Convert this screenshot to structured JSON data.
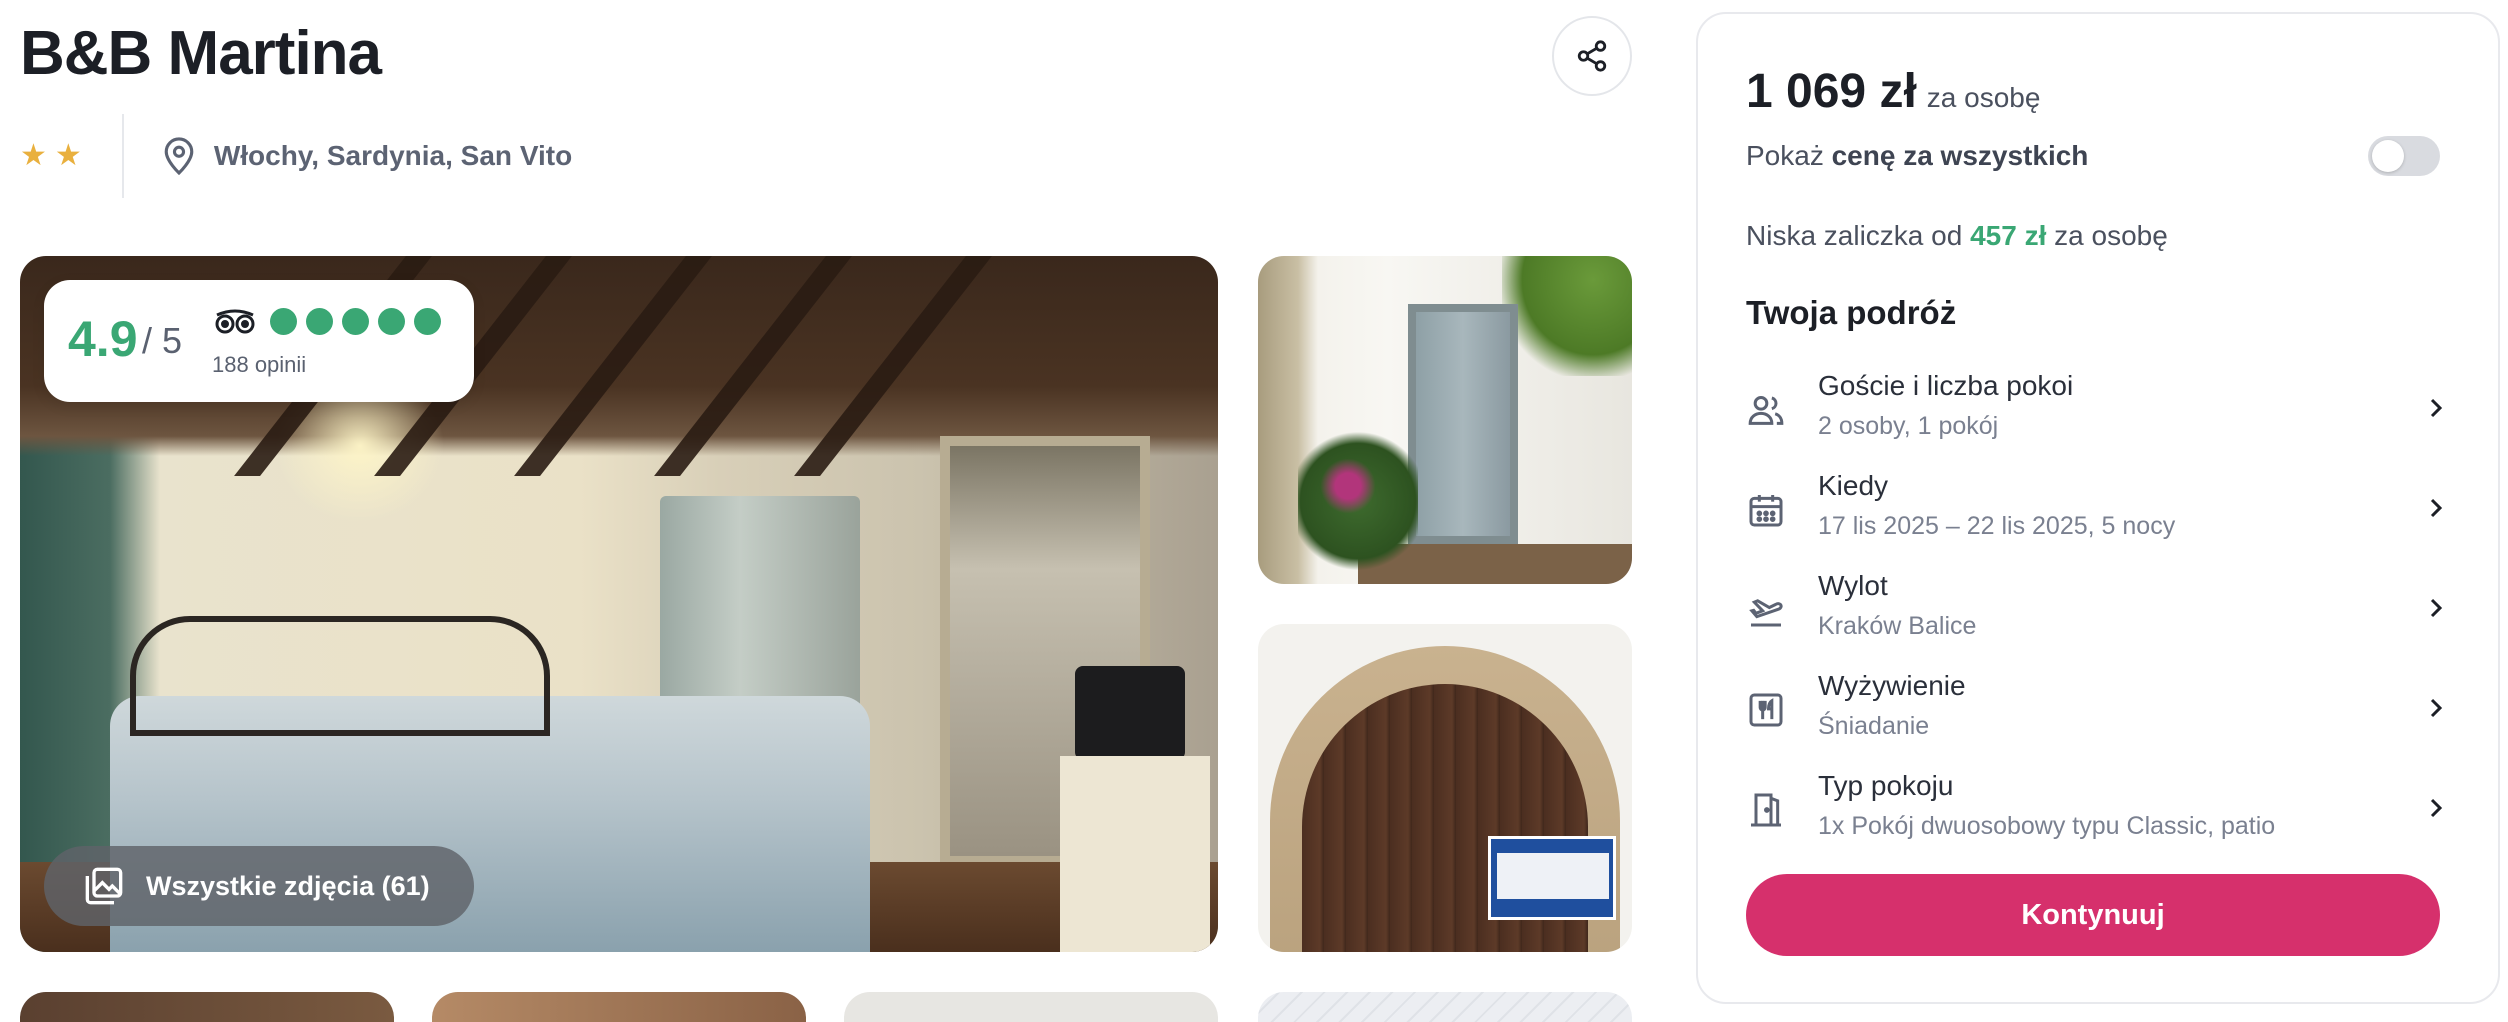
{
  "hotel": {
    "name": "B&B Martina",
    "star_count": 2,
    "location": "Włochy, Sardynia, San Vito"
  },
  "rating": {
    "score": "4.9",
    "of": "/ 5",
    "bubbles": 5,
    "reviews": "188 opinii",
    "color": "#3aa774"
  },
  "gallery": {
    "all_photos_label": "Wszystkie zdjęcia (61)"
  },
  "booking": {
    "price": "1 069 zł",
    "per_person": "za osobę",
    "toggle_prefix": "Pokaż ",
    "toggle_bold": "cenę za wszystkich",
    "toggle_on": false,
    "deposit_prefix": "Niska zaliczka od ",
    "deposit_amount": "457 zł",
    "deposit_suffix": " za osobę",
    "trip_heading": "Twoja podróż",
    "items": [
      {
        "label": "Goście i liczba pokoi",
        "value": "2 osoby, 1 pokój",
        "icon": "users-icon"
      },
      {
        "label": "Kiedy",
        "value": "17 lis 2025 – 22 lis 2025, 5 nocy",
        "icon": "calendar-icon"
      },
      {
        "label": "Wylot",
        "value": "Kraków Balice",
        "icon": "plane-departure-icon"
      },
      {
        "label": "Wyżywienie",
        "value": "Śniadanie",
        "icon": "cutlery-icon"
      },
      {
        "label": "Typ pokoju",
        "value": "1x Pokój dwuosobowy typu Classic, patio",
        "icon": "door-icon"
      }
    ],
    "continue_label": "Kontynuuj"
  },
  "colors": {
    "accent": "#d6306c",
    "green": "#3aa774",
    "star": "#e9b03e"
  }
}
